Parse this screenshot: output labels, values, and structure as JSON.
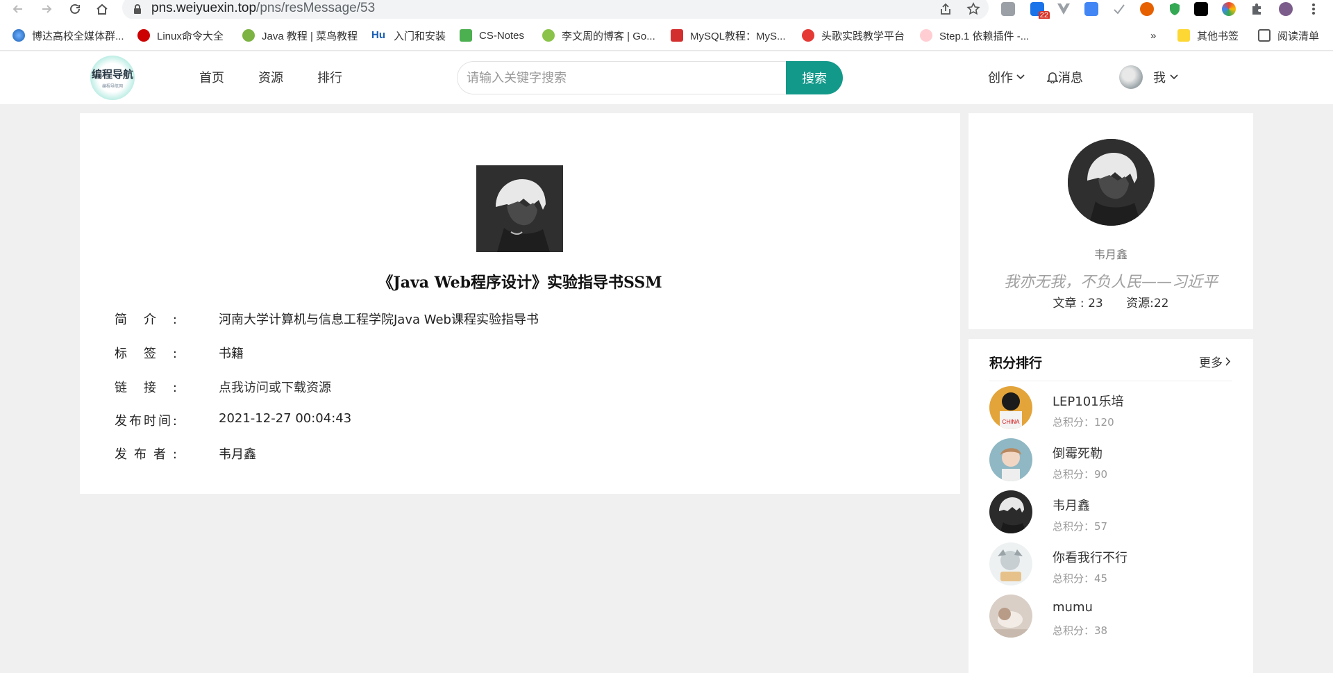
{
  "browser": {
    "url_host": "pns.weiyuexin.top",
    "url_path": "/pns/resMessage/53",
    "extension_badge": "22",
    "bookmarks": [
      {
        "label": "博达高校全媒体群...",
        "icon": "globe-icon"
      },
      {
        "label": "Linux命令大全",
        "icon": "redhat-icon"
      },
      {
        "label": "Java 教程 | 菜鸟教程",
        "icon": "runoob-icon"
      },
      {
        "label": "入门和安装",
        "icon": "hu-icon",
        "icon_text": "Hu"
      },
      {
        "label": "CS-Notes",
        "icon": "notes-icon"
      },
      {
        "label": "李文周的博客 | Go...",
        "icon": "gopher-icon"
      },
      {
        "label": "MySQL教程：MyS...",
        "icon": "c-icon"
      },
      {
        "label": "头歌实践教学平台",
        "icon": "touge-icon"
      },
      {
        "label": "Step.1 依赖插件 -...",
        "icon": "cat-icon"
      }
    ],
    "bookmarks_overflow": "»",
    "other_bookmarks": "其他书签",
    "reading_list": "阅读清单"
  },
  "header": {
    "logo_text": "编程导航",
    "logo_subtext": "编程导航网",
    "nav": [
      "首页",
      "资源",
      "排行"
    ],
    "search_placeholder": "请输入关键字搜索",
    "search_button": "搜索",
    "create_label": "创作",
    "messages_label": "消息",
    "me_label": "我"
  },
  "resource": {
    "title": "《Java Web程序设计》实验指导书SSM",
    "fields": [
      {
        "label": "简介:",
        "value": "河南大学计算机与信息工程学院Java Web课程实验指导书"
      },
      {
        "label": "标签:",
        "value": "书籍"
      },
      {
        "label": "链接:",
        "value": "点我访问或下载资源"
      },
      {
        "label": "发布时间:",
        "value": "2021-12-27 00:04:43"
      },
      {
        "label": "发布者:",
        "value": "韦月鑫"
      }
    ]
  },
  "author": {
    "name": "韦月鑫",
    "motto": "我亦无我，不负人民——习近平",
    "articles_label": "文章 : 23",
    "resources_label": "资源:22"
  },
  "ranking": {
    "title": "积分排行",
    "more_label": "更多",
    "items": [
      {
        "name": "LEP101乐培",
        "score": "总积分：120",
        "avatar_color": "#e3a43a"
      },
      {
        "name": "倒霉死勒",
        "score": "总积分：90",
        "avatar_color": "#8fb8c4"
      },
      {
        "name": "韦月鑫",
        "score": "总积分：57",
        "avatar_color": "#2b2b2b"
      },
      {
        "name": "你看我行不行",
        "score": "总积分：45",
        "avatar_color": "#d7dde0"
      },
      {
        "name": "mumu",
        "score": "总积分：38",
        "avatar_color": "#d9cfc7"
      }
    ]
  },
  "colors": {
    "accent": "#12998a",
    "page_background": "#f0f0f0"
  }
}
